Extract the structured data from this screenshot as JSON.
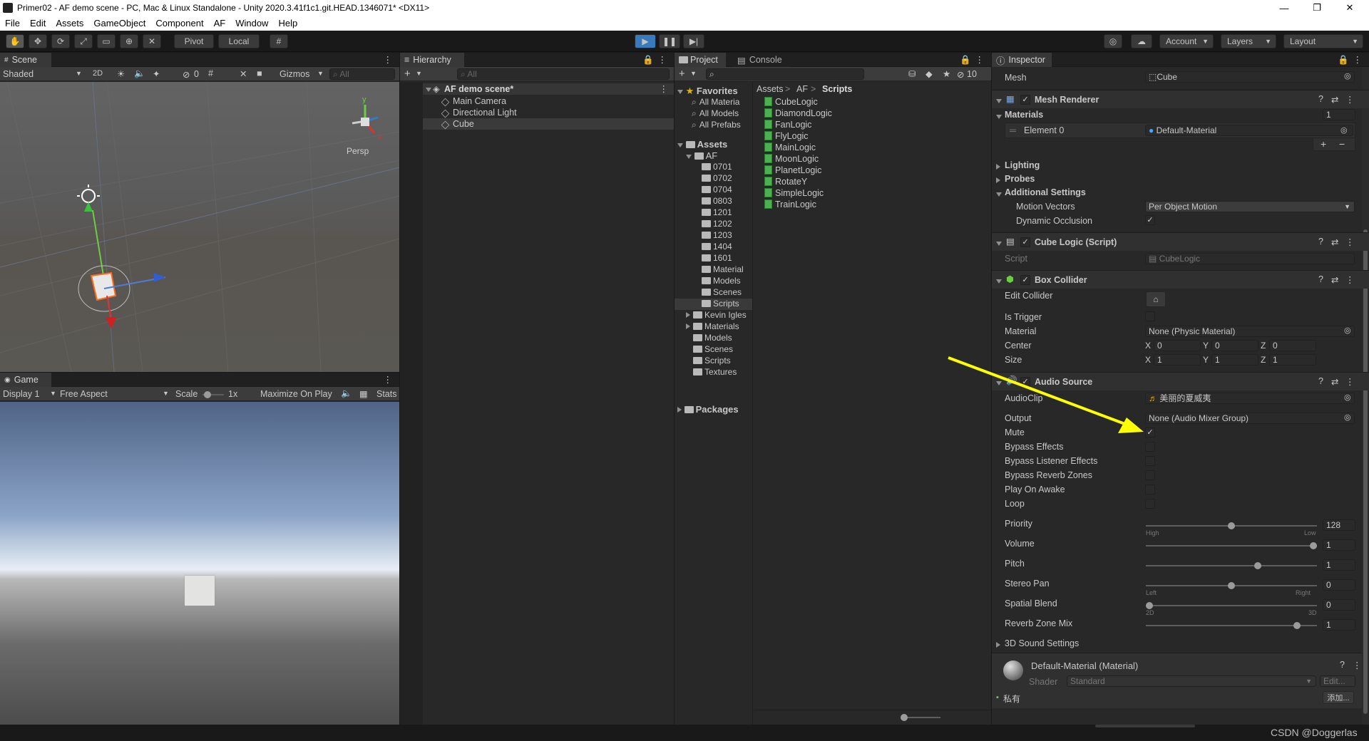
{
  "window": {
    "title": "Primer02 - AF demo scene - PC, Mac & Linux Standalone - Unity 2020.3.41f1c1.git.HEAD.1346071* <DX11>",
    "minimize": "—",
    "maximize": "❐",
    "close": "✕"
  },
  "menu": [
    "File",
    "Edit",
    "Assets",
    "GameObject",
    "Component",
    "AF",
    "Window",
    "Help"
  ],
  "toolbar": {
    "pivot": "Pivot",
    "local": "Local",
    "account": "Account",
    "layers": "Layers",
    "layout": "Layout"
  },
  "scene": {
    "tab": "Scene",
    "shading": "Shaded",
    "mode2d": "2D",
    "hidden_count": "0",
    "gizmos": "Gizmos",
    "search_placeholder": "All",
    "persp": "Persp",
    "axis_y": "y",
    "axis_x": "x"
  },
  "game": {
    "tab": "Game",
    "display": "Display 1",
    "aspect": "Free Aspect",
    "scale_label": "Scale",
    "scale_value": "1x",
    "scale_fraction": 0.1,
    "maximize": "Maximize On Play",
    "stats": "Stats"
  },
  "hierarchy": {
    "tab": "Hierarchy",
    "search_placeholder": "All",
    "scene_name": "AF demo scene*",
    "items": [
      "Main Camera",
      "Directional Light",
      "Cube"
    ],
    "selected_index": 2
  },
  "project": {
    "tab": "Project",
    "console_tab": "Console",
    "hidden_count": "10",
    "favorites_label": "Favorites",
    "favorites": [
      "All Materia",
      "All Models",
      "All Prefabs"
    ],
    "assets_label": "Assets",
    "af_label": "AF",
    "af_folders": [
      "0701",
      "0702",
      "0704",
      "0803",
      "1201",
      "1202",
      "1203",
      "1404",
      "1601",
      "Material",
      "Models",
      "Scenes",
      "Scripts"
    ],
    "asset_folders": [
      "Kevin Igles",
      "Materials",
      "Models",
      "Scenes",
      "Scripts",
      "Textures"
    ],
    "packages_label": "Packages",
    "breadcrumb": [
      "Assets",
      "AF",
      "Scripts"
    ],
    "breadcrumb_sep": ">",
    "scripts": [
      "CubeLogic",
      "DiamondLogic",
      "FanLogic",
      "FlyLogic",
      "MainLogic",
      "MoonLogic",
      "PlanetLogic",
      "RotateY",
      "SimpleLogic",
      "TrainLogic"
    ]
  },
  "inspector": {
    "tab": "Inspector",
    "mesh_label": "Mesh",
    "mesh_value": "Cube",
    "mesh_renderer": "Mesh Renderer",
    "materials_label": "Materials",
    "materials_count": "1",
    "element0_label": "Element 0",
    "element0_value": "Default-Material",
    "plus": "+",
    "minus": "−",
    "lighting": "Lighting",
    "probes": "Probes",
    "additional": "Additional Settings",
    "motion_vectors_label": "Motion Vectors",
    "motion_vectors_value": "Per Object Motion",
    "dynamic_occlusion_label": "Dynamic Occlusion",
    "cube_logic": "Cube Logic (Script)",
    "script_label": "Script",
    "script_value": "CubeLogic",
    "box_collider": "Box Collider",
    "edit_collider": "Edit Collider",
    "is_trigger": "Is Trigger",
    "material_label": "Material",
    "material_value": "None (Physic Material)",
    "center_label": "Center",
    "size_label": "Size",
    "center": {
      "x": "0",
      "y": "0",
      "z": "0"
    },
    "size": {
      "x": "1",
      "y": "1",
      "z": "1"
    },
    "axis_x": "X",
    "axis_y": "Y",
    "axis_z": "Z",
    "audio_source": "Audio Source",
    "audioclip_label": "AudioClip",
    "audioclip_value": "美丽的夏威夷",
    "output_label": "Output",
    "output_value": "None (Audio Mixer Group)",
    "toggles": [
      {
        "label": "Mute",
        "checked": true
      },
      {
        "label": "Bypass Effects",
        "checked": false
      },
      {
        "label": "Bypass Listener Effects",
        "checked": false
      },
      {
        "label": "Bypass Reverb Zones",
        "checked": false
      },
      {
        "label": "Play On Awake",
        "checked": false
      },
      {
        "label": "Loop",
        "checked": false
      }
    ],
    "sliders": [
      {
        "label": "Priority",
        "value": "128",
        "fraction": 0.5,
        "left": "High",
        "right": "Low"
      },
      {
        "label": "Volume",
        "value": "1",
        "fraction": 1.0,
        "left": "",
        "right": ""
      },
      {
        "label": "Pitch",
        "value": "1",
        "fraction": 0.66,
        "left": "",
        "right": ""
      },
      {
        "label": "Stereo Pan",
        "value": "0",
        "fraction": 0.5,
        "left": "Left",
        "right": "Right"
      },
      {
        "label": "Spatial Blend",
        "value": "0",
        "fraction": 0.0,
        "left": "2D",
        "right": "3D"
      },
      {
        "label": "Reverb Zone Mix",
        "value": "1",
        "fraction": 0.9,
        "left": "",
        "right": ""
      }
    ],
    "sound3d": "3D Sound Settings",
    "material_name": "Default-Material (Material)",
    "shader_label": "Shader",
    "shader_value": "Standard",
    "edit_button": "Edit...",
    "private_label": "私有",
    "add_button": "添加..."
  },
  "watermark": "CSDN @Doggerlas",
  "colors": {
    "accent_blue": "#3a79bb",
    "arrow_yellow": "#ffff00",
    "selection": "#2c5d87"
  }
}
